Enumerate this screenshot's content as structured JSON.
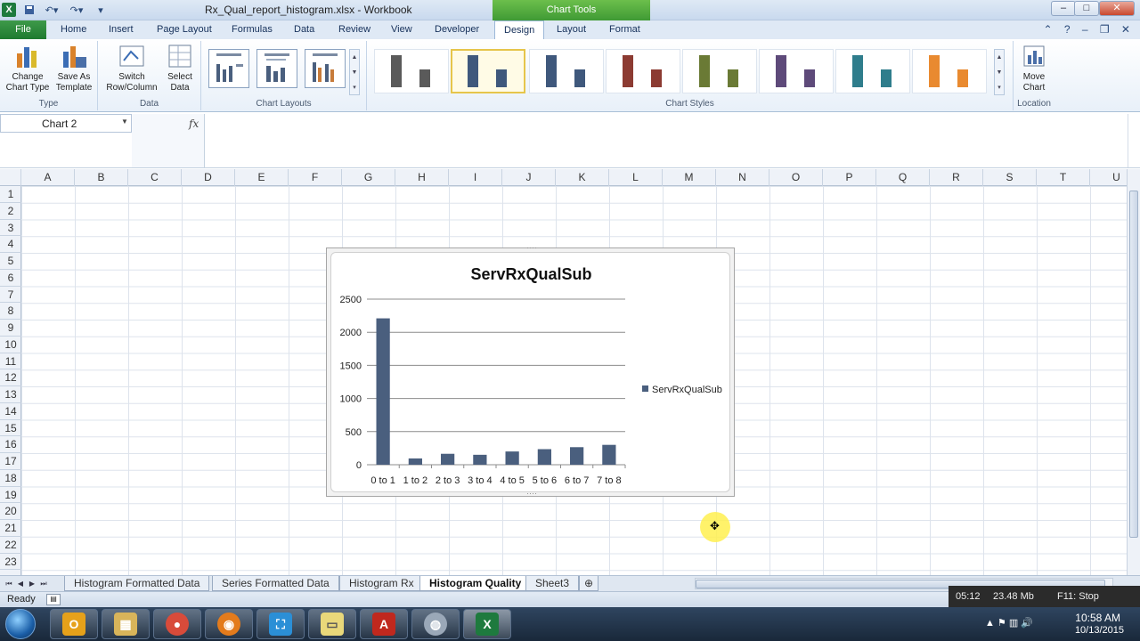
{
  "window": {
    "title": "Rx_Qual_report_histogram.xlsx - Workbook",
    "context_tab": "Chart Tools",
    "minimize": "–",
    "maximize": "□",
    "close": "✕"
  },
  "ribbon_tabs": [
    "File",
    "Home",
    "Insert",
    "Page Layout",
    "Formulas",
    "Data",
    "Review",
    "View",
    "Developer",
    "Design",
    "Layout",
    "Format"
  ],
  "ribbon": {
    "type_group": {
      "label": "Type",
      "change_chart_type": "Change Chart Type",
      "save_as_template": "Save As Template"
    },
    "data_group": {
      "label": "Data",
      "switch_row_column": "Switch Row/Column",
      "select_data": "Select Data"
    },
    "layouts_group": {
      "label": "Chart Layouts"
    },
    "styles_group": {
      "label": "Chart Styles"
    },
    "location_group": {
      "label": "Location",
      "move_chart": "Move Chart"
    }
  },
  "formula_bar": {
    "name_box": "Chart 2",
    "fx": "fx",
    "value": ""
  },
  "columns": [
    "A",
    "B",
    "C",
    "D",
    "E",
    "F",
    "G",
    "H",
    "I",
    "J",
    "K",
    "L",
    "M",
    "N",
    "O",
    "P",
    "Q",
    "R",
    "S",
    "T",
    "U"
  ],
  "rows": [
    "1",
    "2",
    "3",
    "4",
    "5",
    "6",
    "7",
    "8",
    "9",
    "10",
    "11",
    "12",
    "13",
    "14",
    "15",
    "16",
    "17",
    "18",
    "19",
    "20",
    "21",
    "22",
    "23"
  ],
  "chart_data": {
    "type": "bar",
    "title": "ServRxQualSub",
    "categories": [
      "0 to 1",
      "1 to 2",
      "2 to 3",
      "3 to 4",
      "4 to 5",
      "5 to 6",
      "6 to 7",
      "7 to 8"
    ],
    "series": [
      {
        "name": "ServRxQualSub",
        "values": [
          2210,
          95,
          165,
          150,
          200,
          235,
          265,
          300
        ]
      }
    ],
    "ylim": [
      0,
      2500
    ],
    "yticks": [
      0,
      500,
      1000,
      1500,
      2000,
      2500
    ],
    "grid": true,
    "legend": "right",
    "bar_color": "#4a5f7e"
  },
  "sheet_tabs": [
    "Histogram Formatted Data",
    "Series Formatted Data",
    "Histogram Rx",
    "Histogram Quality",
    "Sheet3"
  ],
  "active_sheet": "Histogram Quality",
  "status": {
    "ready": "Ready"
  },
  "recorder": {
    "time": "05:12",
    "size": "23.48 Mb",
    "stop": "F11: Stop"
  },
  "clock": {
    "time": "10:58 AM",
    "date": "10/13/2015"
  }
}
